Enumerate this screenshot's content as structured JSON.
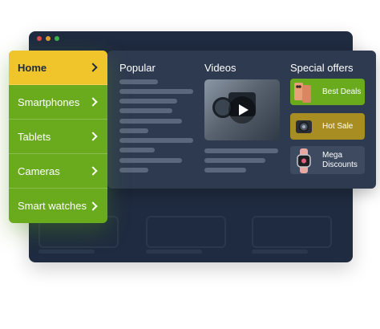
{
  "window": {
    "dots": [
      "#e04b4b",
      "#e0a030",
      "#3fb34f"
    ],
    "background": "#1f2b40"
  },
  "menu": {
    "items": [
      {
        "label": "Home",
        "active": true
      },
      {
        "label": "Smartphones",
        "active": false
      },
      {
        "label": "Tablets",
        "active": false
      },
      {
        "label": "Cameras",
        "active": false
      },
      {
        "label": "Smart watches",
        "active": false
      }
    ],
    "accent_active": "#f0c52b",
    "accent": "#6aab1e"
  },
  "panel": {
    "popular_title": "Popular",
    "videos_title": "Videos",
    "offers_title": "Special offers",
    "offers": [
      {
        "label": "Best Deals",
        "color": "#6aab1e",
        "icon": "phone-icon"
      },
      {
        "label": "Hot Sale",
        "color": "#a88d23",
        "icon": "camera-icon"
      },
      {
        "label": "Mega Discounts",
        "color": "#3d4a60",
        "icon": "watch-icon"
      }
    ]
  }
}
